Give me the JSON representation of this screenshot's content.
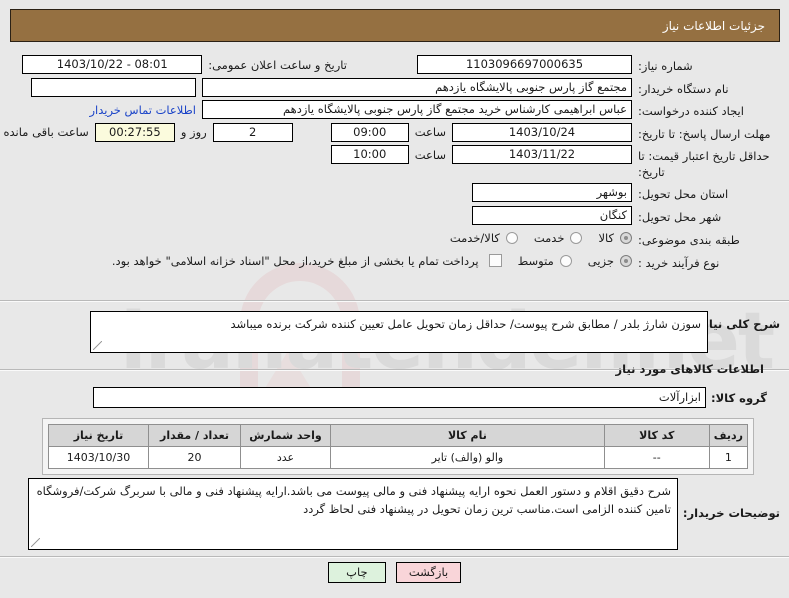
{
  "window": {
    "title": "جزئیات اطلاعات نیاز"
  },
  "colors": {
    "header_bg": "#957041",
    "header_text": "#ffffff",
    "page_bg": "#e8e8e8",
    "link": "#1b44c8",
    "timer_bg": "#fbfbdd",
    "print_button_bg": "#ddf2dd",
    "back_button_bg": "#f9d5d9"
  },
  "form": {
    "need_number": {
      "label": "شماره نیاز:",
      "value": "1103096697000635"
    },
    "announce_datetime": {
      "label": "تاریخ و ساعت اعلان عمومی:",
      "value": "1403/10/22 - 08:01"
    },
    "buyer_org": {
      "label": "نام دستگاه خریدار:",
      "value": "مجتمع گاز پارس جنوبی  پالایشگاه یازدهم",
      "secondary_value": ""
    },
    "requester": {
      "label": "ایجاد کننده درخواست:",
      "value": "عباس ابراهیمی کارشناس خرید مجتمع گاز پارس جنوبی  پالایشگاه یازدهم",
      "contact_link": "اطلاعات تماس خریدار"
    },
    "response_deadline": {
      "label": "مهلت ارسال پاسخ: تا تاریخ:",
      "date": "1403/10/24",
      "time_label": "ساعت",
      "time": "09:00",
      "remaining_days": "2",
      "days_label": "روز و",
      "remaining_time": "00:27:55",
      "remaining_label": "ساعت باقی مانده"
    },
    "price_validity": {
      "label": "حداقل تاریخ اعتبار قیمت: تا تاریخ:",
      "date": "1403/11/22",
      "time_label": "ساعت",
      "time": "10:00"
    },
    "delivery_province": {
      "label": "استان محل تحویل:",
      "value": "بوشهر"
    },
    "delivery_city": {
      "label": "شهر محل تحویل:",
      "value": "کنگان"
    },
    "subject_category": {
      "label": "طبقه بندی موضوعی:",
      "options": [
        {
          "label": "کالا",
          "selected": true
        },
        {
          "label": "خدمت",
          "selected": false
        },
        {
          "label": "کالا/خدمت",
          "selected": false
        }
      ]
    },
    "purchase_type": {
      "label": "نوع فرآیند خرید :",
      "options": [
        {
          "label": "جزیی",
          "selected": true
        },
        {
          "label": "متوسط",
          "selected": false
        }
      ],
      "islamic_treasury": {
        "checked": false,
        "label": "پرداخت تمام یا بخشی از مبلغ خرید،از محل \"اسناد خزانه اسلامی\" خواهد بود."
      }
    }
  },
  "summary": {
    "label": "شرح کلی نیاز:",
    "value": "سوزن شارژ بلدر / مطابق شرح پیوست/ حداقل زمان تحویل عامل تعیین کننده شرکت برنده میباشد"
  },
  "goods_section": {
    "title": "اطلاعات کالاهای مورد نیاز",
    "group": {
      "label": "گروه کالا:",
      "value": "ابزارآلات"
    },
    "table": {
      "headers": [
        "ردیف",
        "کد کالا",
        "نام کالا",
        "واحد شمارش",
        "تعداد / مقدار",
        "تاریخ نیاز"
      ],
      "rows": [
        {
          "row_no": "1",
          "code": "--",
          "name": "والو (والف) تایر",
          "unit": "عدد",
          "quantity": "20",
          "need_date": "1403/10/30"
        }
      ]
    }
  },
  "buyer_notes": {
    "label": "توضیحات خریدار:",
    "value": "شرح دقیق اقلام و دستور العمل نحوه ارایه پیشنهاد فنی و مالی پیوست می باشد.ارایه پیشنهاد فنی و مالی با سربرگ شرکت/فروشگاه تامین کننده الزامی است.مناسب ترین زمان تحویل در پیشنهاد فنی لحاظ گردد"
  },
  "footer": {
    "print_label": "چاپ",
    "back_label": "بازگشت"
  },
  "watermark": {
    "text": "iranatender.net"
  }
}
